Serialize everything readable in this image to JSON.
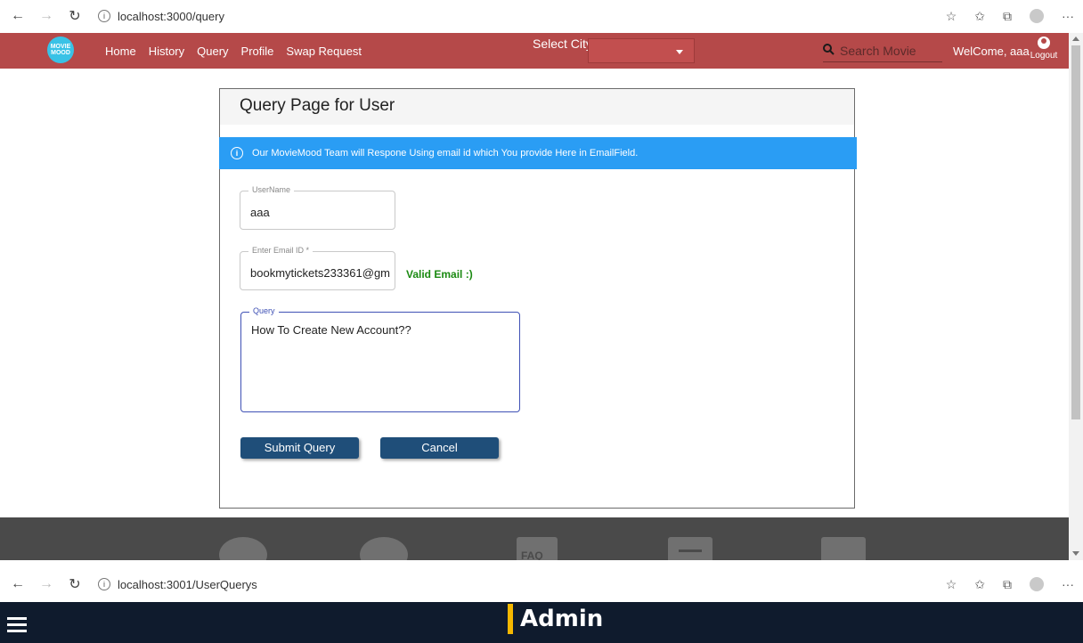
{
  "browser_top": {
    "url": "localhost:3000/query"
  },
  "browser_bottom": {
    "url": "localhost:3001/UserQuerys"
  },
  "nav": {
    "logo_text": "MOVIE MOOD",
    "items": [
      "Home",
      "History",
      "Query",
      "Profile",
      "Swap Request"
    ],
    "city_label": "Select City",
    "search_placeholder": "Search Movie",
    "welcome": "WelCome, aaa",
    "logout": "Logout"
  },
  "card": {
    "title": "Query Page for User",
    "info": "Our MovieMood Team will Respone Using email id which You provide Here in EmailField."
  },
  "form": {
    "username_label": "UserName",
    "username_value": "aaa",
    "email_label": "Enter Email ID *",
    "email_value": "bookmytickets233361@gm",
    "valid_text": "Valid Email :)",
    "query_label": "Query",
    "query_value": "How To Create New Account??",
    "submit": "Submit Query",
    "cancel": "Cancel"
  },
  "footer": {
    "faq": "FAQ"
  },
  "admin": {
    "title": "Admin"
  },
  "colors": {
    "nav": "#b54949",
    "accent": "#2a9df4",
    "button": "#1f4e79",
    "valid": "#1b8a12",
    "admin_bg": "#0f1b2d",
    "admin_accent": "#f5b800"
  },
  "icons": [
    "back-icon",
    "forward-icon",
    "refresh-icon",
    "info-icon",
    "favorite-icon",
    "collections-icon",
    "profile-icon",
    "more-icon",
    "search-icon",
    "user-icon",
    "hamburger-icon"
  ]
}
